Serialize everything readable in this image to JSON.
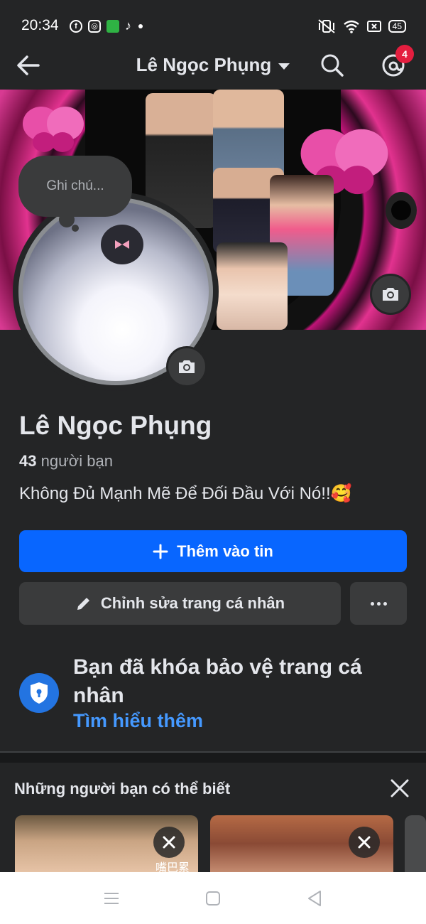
{
  "status_bar": {
    "time": "20:34",
    "battery": "45",
    "app_icons": [
      "facebook-icon",
      "instagram-icon",
      "wechat-icon",
      "tiktok-icon"
    ],
    "system_icons": [
      "mute-vibrate-icon",
      "wifi-icon",
      "screen-icon",
      "battery-icon"
    ]
  },
  "header": {
    "title": "Lê Ngọc Phụng",
    "notification_badge": "4",
    "colors": {
      "badge": "#e41e3f"
    }
  },
  "note": {
    "placeholder": "Ghi chú..."
  },
  "profile": {
    "name": "Lê Ngọc Phụng",
    "friends_count": "43",
    "friends_label": "người bạn",
    "bio": "Không Đủ Mạnh Mẽ Để Đối Đầu Với Nó!!🥰"
  },
  "actions": {
    "add_story": "Thêm vào tin",
    "edit_profile": "Chỉnh sửa trang cá nhân",
    "colors": {
      "primary": "#0866ff",
      "secondary": "#3a3b3c"
    }
  },
  "lock_notice": {
    "title": "Bạn đã khóa bảo vệ trang cá nhân",
    "link": "Tìm hiểu thêm",
    "colors": {
      "link": "#4599ff"
    }
  },
  "people_you_may_know": {
    "title": "Những người bạn có thể biết",
    "card_overlay_text": "嘴巴累"
  },
  "theme": {
    "background": "#242526",
    "text": "#e4e6eb"
  }
}
